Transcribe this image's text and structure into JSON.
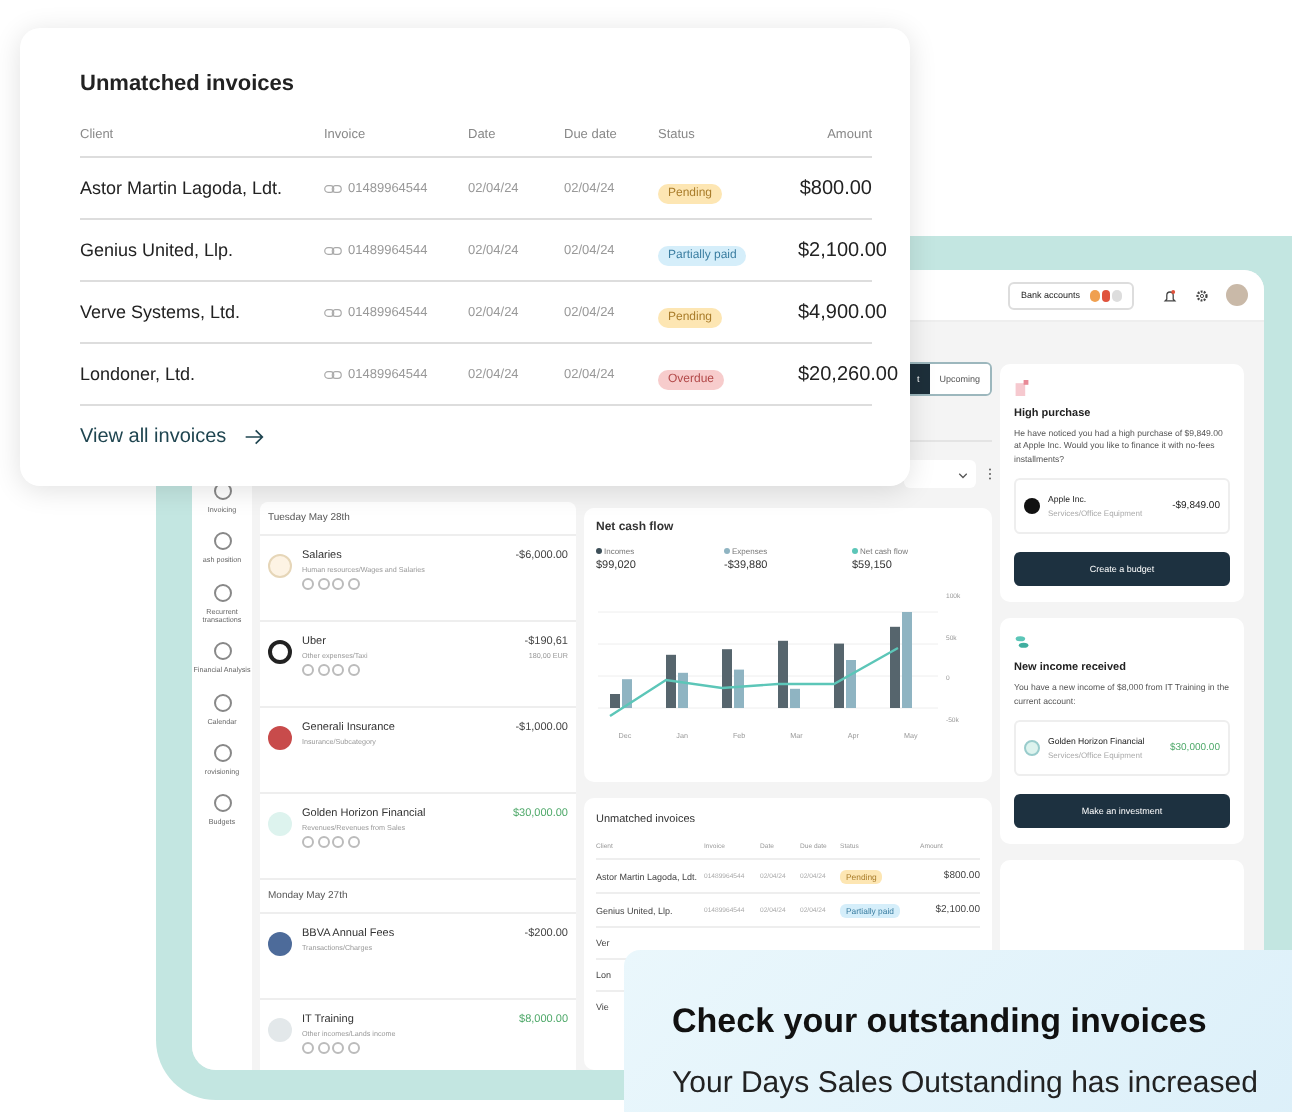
{
  "app": {
    "topbar": {
      "bank_accounts": "Bank accounts"
    },
    "sidebar": {
      "items": [
        {
          "label": "Invoicing"
        },
        {
          "label": "ash position"
        },
        {
          "label": "Recurrent transactions"
        },
        {
          "label": "Financial Analysis"
        },
        {
          "label": "Calendar"
        },
        {
          "label": "rovisioning"
        },
        {
          "label": "Budgets"
        }
      ]
    },
    "tabs": [
      {
        "label": "t",
        "selected": true
      },
      {
        "label": "Upcoming",
        "selected": false
      }
    ],
    "transactions": [
      {
        "title": "Tuesday May 28th",
        "items": [
          {
            "kind": "outline",
            "name": "Salaries",
            "category": "Human resources/Wages and Salaries",
            "amount": "-$6,000.00",
            "income": false,
            "tagged": true
          },
          {
            "kind": "ring",
            "name": "Uber",
            "category": "Other expenses/Taxi",
            "amount": "-$190,61",
            "sub_amount": "180,00 EUR",
            "income": false,
            "tagged": true
          },
          {
            "kind": "red",
            "name": "Generali Insurance",
            "category": "Insurance/Subcategory",
            "amount": "-$1,000.00",
            "income": false,
            "tagged": false
          },
          {
            "kind": "mint",
            "name": "Golden Horizon Financial",
            "category": "Revenues/Revenues from Sales",
            "amount": "$30,000.00",
            "income": true,
            "tagged": true
          }
        ]
      },
      {
        "title": "Monday May 27th",
        "items": [
          {
            "kind": "blue",
            "name": "BBVA Annual Fees",
            "category": "Transactions/Charges",
            "amount": "-$200.00",
            "income": false,
            "tagged": false
          },
          {
            "kind": "grey",
            "name": "IT Training",
            "category": "Other incomes/Lands income",
            "amount": "$8,000.00",
            "income": true,
            "tagged": true
          }
        ]
      }
    ],
    "cash_flow": {
      "title": "Net cash flow",
      "legend": [
        {
          "label": "Incomes",
          "value": "$99,020",
          "color": "#3d4f58"
        },
        {
          "label": "Expenses",
          "value": "-$39,880",
          "color": "#8fb4c2"
        },
        {
          "label": "Net cash flow",
          "value": "$59,150",
          "color": "#5cc6b8"
        }
      ],
      "y_labels": [
        "100k",
        "50k",
        "0",
        "-50k"
      ],
      "months": [
        "Dec",
        "Jan",
        "Feb",
        "Mar",
        "Apr",
        "May"
      ]
    },
    "small_invoices": {
      "title": "Unmatched invoices",
      "columns": [
        "Client",
        "Invoice",
        "Date",
        "Due date",
        "Status",
        "Amount"
      ],
      "rows": [
        {
          "client": "Astor Martin Lagoda, Ldt.",
          "invoice": "01489964544",
          "date": "02/04/24",
          "due": "02/04/24",
          "status": "Pending",
          "kind": "pending",
          "amount": "$800.00"
        },
        {
          "client": "Genius United, Llp.",
          "invoice": "01489964544",
          "date": "02/04/24",
          "due": "02/04/24",
          "status": "Partially paid",
          "kind": "partial",
          "amount": "$2,100.00"
        }
      ],
      "cut_rows": [
        "Ver",
        "Lon"
      ],
      "link": "Vie"
    },
    "alerts": [
      {
        "kind": "purchase",
        "title": "High purchase",
        "text": "He have noticed you had a high purchase of $9,849.00 at Apple Inc. Would you like to finance it with no-fees installments?",
        "merchant": "Apple Inc.",
        "merchant_category": "Services/Office Equipment",
        "amount": "-$9,849.00",
        "income": false,
        "button": "Create a budget"
      },
      {
        "kind": "income",
        "title": "New income received",
        "text": "You have a new income of $8,000 from IT Training in the current account:",
        "merchant": "Golden Horizon Financial",
        "merchant_category": "Services/Office Equipment",
        "amount": "$30,000.00",
        "income": true,
        "button": "Make an investment"
      }
    ]
  },
  "invoices_card": {
    "title": "Unmatched invoices",
    "columns": [
      "Client",
      "Invoice",
      "Date",
      "Due date",
      "Status",
      "Amount"
    ],
    "rows": [
      {
        "client": "Astor Martin Lagoda, Ldt.",
        "invoice": "01489964544",
        "date": "02/04/24",
        "due": "02/04/24",
        "status": "Pending",
        "kind": "pending",
        "amount": "$800.00"
      },
      {
        "client": "Genius United, Llp.",
        "invoice": "01489964544",
        "date": "02/04/24",
        "due": "02/04/24",
        "status": "Partially paid",
        "kind": "partial",
        "amount": "$2,100.00"
      },
      {
        "client": "Verve Systems, Ltd.",
        "invoice": "01489964544",
        "date": "02/04/24",
        "due": "02/04/24",
        "status": "Pending",
        "kind": "pending",
        "amount": "$4,900.00"
      },
      {
        "client": "Londoner, Ltd.",
        "invoice": "01489964544",
        "date": "02/04/24",
        "due": "02/04/24",
        "status": "Overdue",
        "kind": "overdue",
        "amount": "$20,260.00"
      }
    ],
    "link": "View all invoices"
  },
  "callout": {
    "title": "Check your outstanding invoices",
    "text": "Your Days Sales Outstanding has increased"
  }
}
